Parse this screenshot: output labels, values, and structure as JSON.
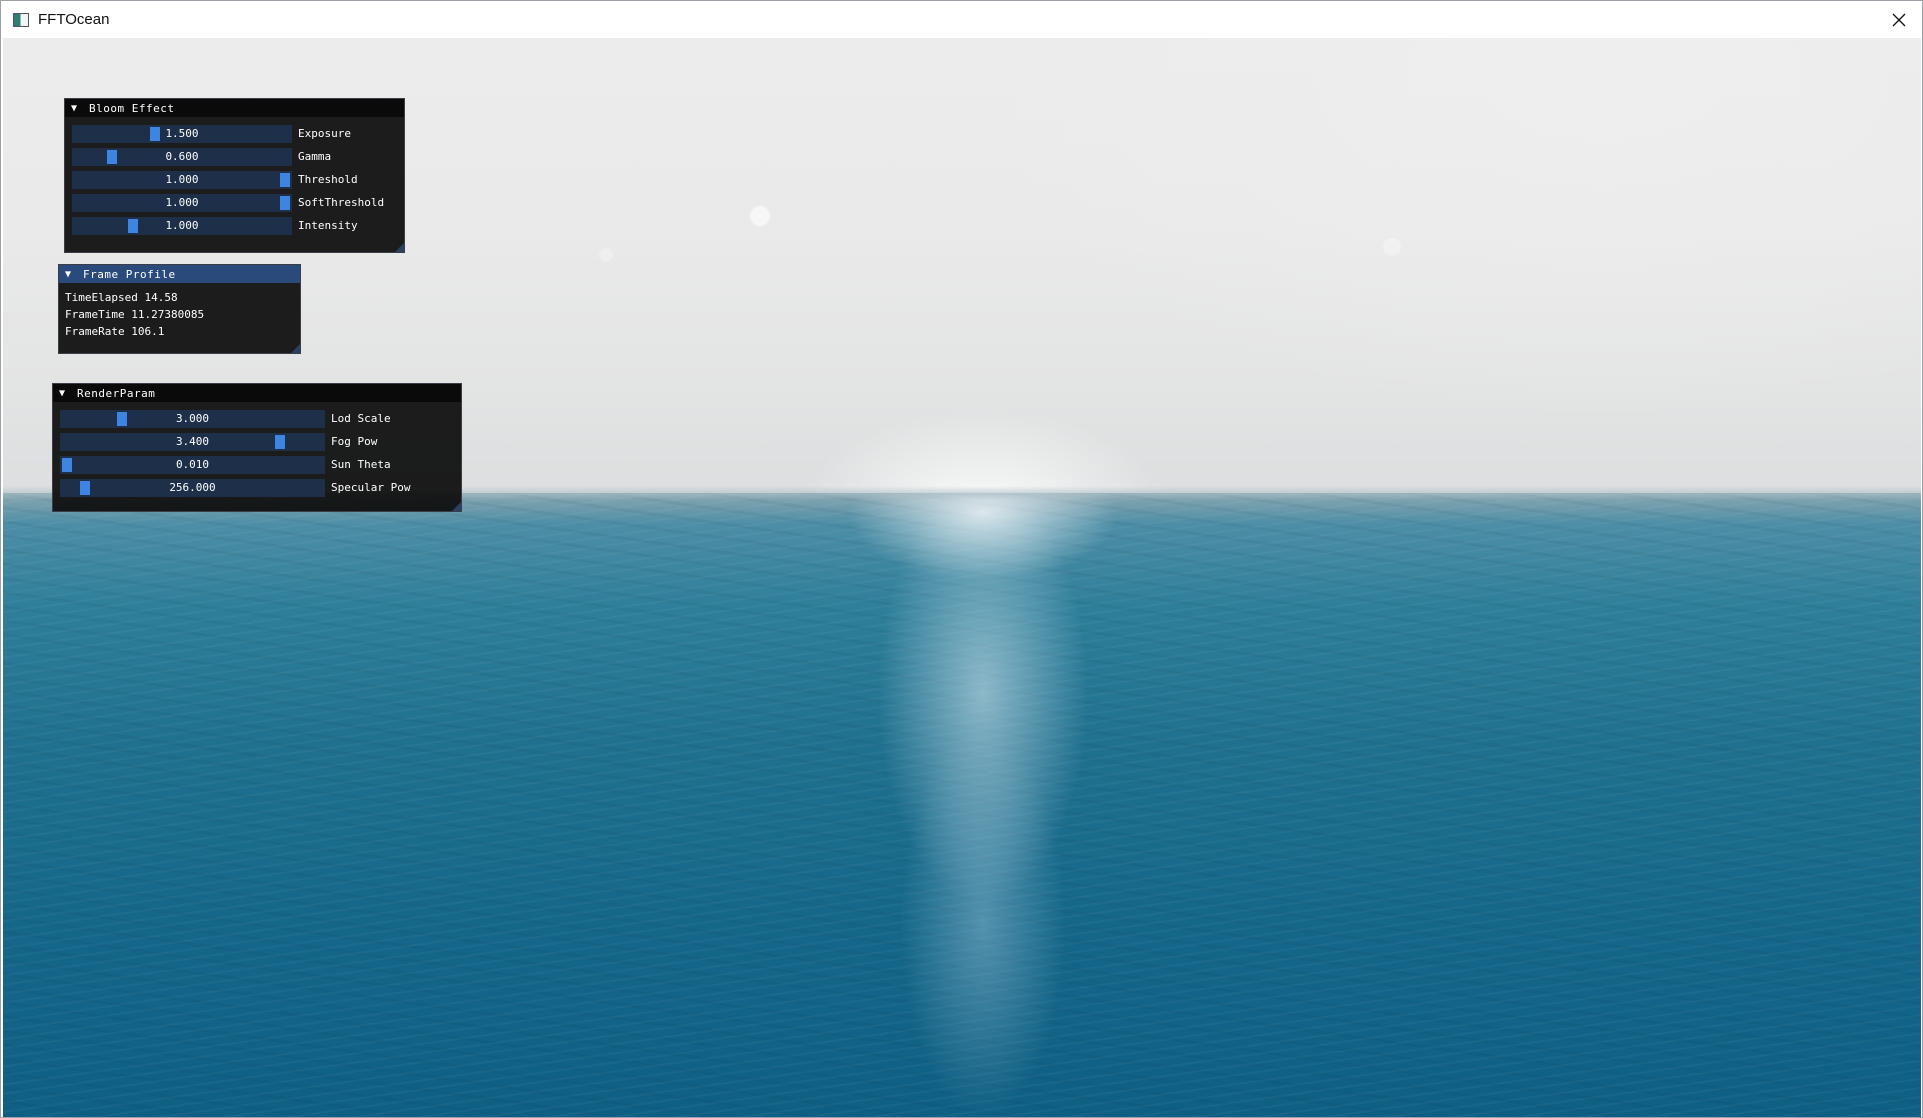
{
  "window": {
    "title": "FFTOcean",
    "close_icon": "close-icon",
    "app_icon": "app-icon"
  },
  "bloom": {
    "title": "Bloom Effect",
    "sliders": [
      {
        "label": "Exposure",
        "value": "1.500",
        "fraction": 0.37
      },
      {
        "label": "Gamma",
        "value": "0.600",
        "fraction": 0.16
      },
      {
        "label": "Threshold",
        "value": "1.000",
        "fraction": 1.0
      },
      {
        "label": "SoftThreshold",
        "value": "1.000",
        "fraction": 1.0
      },
      {
        "label": "Intensity",
        "value": "1.000",
        "fraction": 0.26
      }
    ]
  },
  "profile": {
    "title": "Frame Profile",
    "lines": [
      "TimeElapsed 14.58",
      "FrameTime 11.27380085",
      "FrameRate 106.1"
    ]
  },
  "render": {
    "title": "RenderParam",
    "sliders": [
      {
        "label": "Lod Scale",
        "value": "3.000",
        "fraction": 0.22
      },
      {
        "label": "Fog Pow",
        "value": "3.400",
        "fraction": 0.85
      },
      {
        "label": "Sun Theta",
        "value": "0.010",
        "fraction": 0.0
      },
      {
        "label": "Specular Pow",
        "value": "256.000",
        "fraction": 0.07
      }
    ]
  },
  "colors": {
    "panel_bg": "#0f0f0f",
    "slider_bg": "#1d2f49",
    "slider_grab": "#3d85e0",
    "header_active": "#294a7a"
  }
}
